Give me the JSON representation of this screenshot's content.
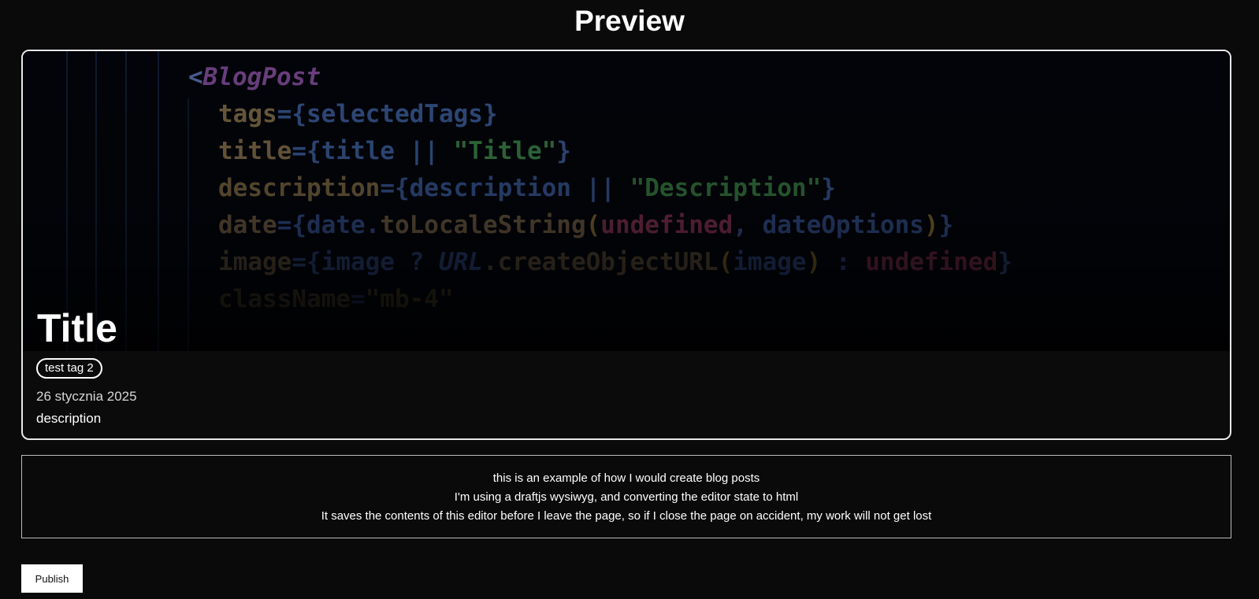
{
  "page": {
    "heading": "Preview"
  },
  "post": {
    "title": "Title",
    "tag": "test tag 2",
    "date": "26 stycznia 2025",
    "description": "description",
    "cover_code_lines": [
      [
        {
          "t": "<",
          "c": "#4a5c8e"
        },
        {
          "t": "BlogPost",
          "c": "#6a3f7e",
          "i": true
        }
      ],
      [
        {
          "t": "tags",
          "c": "#6b5a3c"
        },
        {
          "t": "={",
          "c": "#2f4a7a"
        },
        {
          "t": "selectedTags",
          "c": "#2f4a7a"
        },
        {
          "t": "}",
          "c": "#2f4a7a"
        }
      ],
      [
        {
          "t": "title",
          "c": "#6b5a3c"
        },
        {
          "t": "={",
          "c": "#2f4a7a"
        },
        {
          "t": "title ",
          "c": "#2f4a7a"
        },
        {
          "t": "|| ",
          "c": "#2f4a7a"
        },
        {
          "t": "\"Title\"",
          "c": "#2f6b3a"
        },
        {
          "t": "}",
          "c": "#2f4a7a"
        }
      ],
      [
        {
          "t": "description",
          "c": "#5e4e33"
        },
        {
          "t": "={",
          "c": "#2a4270"
        },
        {
          "t": "description ",
          "c": "#2a4270"
        },
        {
          "t": "|| ",
          "c": "#2a4270"
        },
        {
          "t": "\"Description\"",
          "c": "#2a5e33"
        },
        {
          "t": "}",
          "c": "#2a4270"
        }
      ],
      [
        {
          "t": "date",
          "c": "#4f4230"
        },
        {
          "t": "={",
          "c": "#243863"
        },
        {
          "t": "date.",
          "c": "#243863"
        },
        {
          "t": "toLocaleString",
          "c": "#4f4230"
        },
        {
          "t": "(",
          "c": "#5e4e20"
        },
        {
          "t": "undefined",
          "c": "#5e2439"
        },
        {
          "t": ", ",
          "c": "#243863"
        },
        {
          "t": "dateOptions",
          "c": "#243863"
        },
        {
          "t": ")",
          "c": "#5e4e20"
        },
        {
          "t": "}",
          "c": "#243863"
        }
      ],
      [
        {
          "t": "image",
          "c": "#3b3226"
        },
        {
          "t": "={",
          "c": "#1c2c4f"
        },
        {
          "t": "image ? ",
          "c": "#1c2c4f"
        },
        {
          "t": "URL",
          "c": "#1c2c4f",
          "i": true
        },
        {
          "t": ".createObjectURL",
          "c": "#3b3226"
        },
        {
          "t": "(",
          "c": "#4a3d18"
        },
        {
          "t": "image",
          "c": "#1c2c4f"
        },
        {
          "t": ")",
          "c": "#4a3d18"
        },
        {
          "t": " : ",
          "c": "#1c2c4f"
        },
        {
          "t": "undefined",
          "c": "#4a1c2d"
        },
        {
          "t": "}",
          "c": "#1c2c4f"
        }
      ],
      [
        {
          "t": "className",
          "c": "#2a241b"
        },
        {
          "t": "=",
          "c": "#141f38"
        },
        {
          "t": "\"mb-4\"",
          "c": "#2a2418"
        }
      ]
    ]
  },
  "editor": {
    "lines": [
      "this is an example of how I would create blog posts",
      "I'm using a draftjs wysiwyg, and converting the editor state to html",
      "It saves the contents of this editor before I leave the page, so if I close the page on accident, my work will not get lost"
    ]
  },
  "actions": {
    "publish_label": "Publish"
  },
  "colors": {
    "background": "#0a0a0a",
    "card_border": "#e8e8e8",
    "button_bg": "#ffffff"
  }
}
